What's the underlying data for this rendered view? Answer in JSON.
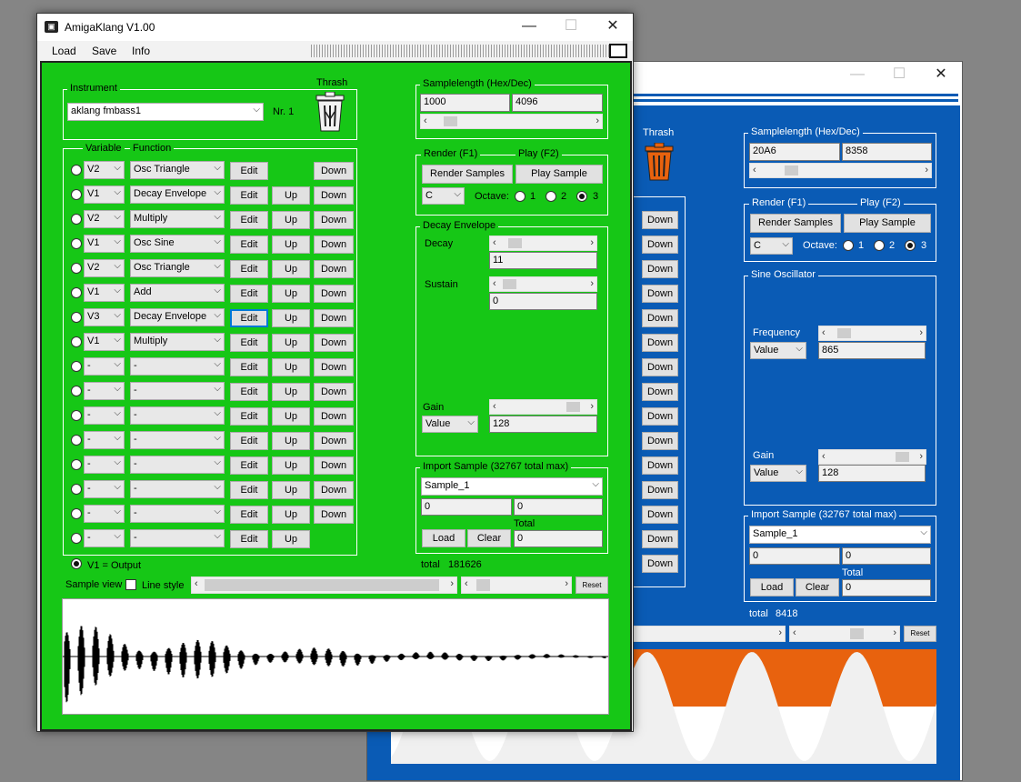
{
  "back": {
    "samplelength_label": "Samplelength (Hex/Dec)",
    "hex": "20A6",
    "dec": "8358",
    "render_label": "Render (F1)",
    "play_label": "Play (F2)",
    "render_button": "Render Samples",
    "play_button": "Play Sample",
    "note": "C",
    "octave_label": "Octave:",
    "oct1": "1",
    "oct2": "2",
    "oct3": "3",
    "osc_group": "Sine Oscillator",
    "frequency_label": "Frequency",
    "freq_mode": "Value",
    "freq_value": "865",
    "gain_label": "Gain",
    "gain_mode": "Value",
    "gain_value": "128",
    "import_label": "Import Sample  (32767 total max)",
    "sample_select": "Sample_1",
    "field_a": "0",
    "field_b": "0",
    "load": "Load",
    "clear": "Clear",
    "total_label": "Total",
    "total_value": "0",
    "total_bottom_label": "total",
    "total_bottom_value": "8418",
    "reset": "Reset",
    "thrash": "Thrash",
    "down": "Down",
    "minimize": "—",
    "maximize": "☐",
    "close": "✕"
  },
  "front": {
    "title": "AmigaKlang V1.00",
    "menu": [
      "Load",
      "Save",
      "Info"
    ],
    "minimize": "—",
    "maximize": "☐",
    "close": "✕",
    "instrument_label": "Instrument",
    "instrument": "aklang fmbass1",
    "nr": "Nr. 1",
    "thrash": "Thrash",
    "variable_label": "Variable",
    "function_label": "Function",
    "edit": "Edit",
    "up": "Up",
    "down": "Down",
    "rows": [
      {
        "var": "V2",
        "func": "Osc Triangle",
        "up": false,
        "down": true
      },
      {
        "var": "V1",
        "func": "Decay Envelope",
        "up": true,
        "down": true
      },
      {
        "var": "V2",
        "func": "Multiply",
        "up": true,
        "down": true
      },
      {
        "var": "V1",
        "func": "Osc Sine",
        "up": true,
        "down": true
      },
      {
        "var": "V2",
        "func": "Osc Triangle",
        "up": true,
        "down": true
      },
      {
        "var": "V1",
        "func": "Add",
        "up": true,
        "down": true
      },
      {
        "var": "V3",
        "func": "Decay Envelope",
        "up": true,
        "down": true,
        "focus": true
      },
      {
        "var": "V1",
        "func": "Multiply",
        "up": true,
        "down": true
      },
      {
        "var": "-",
        "func": "-",
        "up": true,
        "down": true
      },
      {
        "var": "-",
        "func": "-",
        "up": true,
        "down": true
      },
      {
        "var": "-",
        "func": "-",
        "up": true,
        "down": true
      },
      {
        "var": "-",
        "func": "-",
        "up": true,
        "down": true
      },
      {
        "var": "-",
        "func": "-",
        "up": true,
        "down": true
      },
      {
        "var": "-",
        "func": "-",
        "up": true,
        "down": true
      },
      {
        "var": "-",
        "func": "-",
        "up": true,
        "down": true
      },
      {
        "var": "-",
        "func": "-",
        "up": true,
        "down": false
      }
    ],
    "output_label": "V1 = Output",
    "samplelength_label": "Samplelength (Hex/Dec)",
    "hex": "1000",
    "dec": "4096",
    "render_label": "Render (F1)",
    "play_label": "Play (F2)",
    "render_button": "Render Samples",
    "play_button": "Play Sample",
    "note": "C",
    "octave_label": "Octave:",
    "oct1": "1",
    "oct2": "2",
    "oct3": "3",
    "decay_group": "Decay Envelope",
    "decay_label": "Decay",
    "decay_value": "11",
    "sustain_label": "Sustain",
    "sustain_value": "0",
    "gain_label": "Gain",
    "gain_mode": "Value",
    "gain_value": "128",
    "import_label": "Import Sample  (32767 total max)",
    "sample_select": "Sample_1",
    "field_a": "0",
    "field_b": "0",
    "load": "Load",
    "clear": "Clear",
    "total_label": "Total",
    "total_value": "0",
    "total_bottom_label": "total",
    "total_bottom_value": "181626",
    "sample_view_label": "Sample view",
    "line_style_label": "Line style",
    "reset": "Reset"
  },
  "colors": {
    "green": "#16c716",
    "blue": "#0a5bb5",
    "orange": "#e8620e"
  }
}
